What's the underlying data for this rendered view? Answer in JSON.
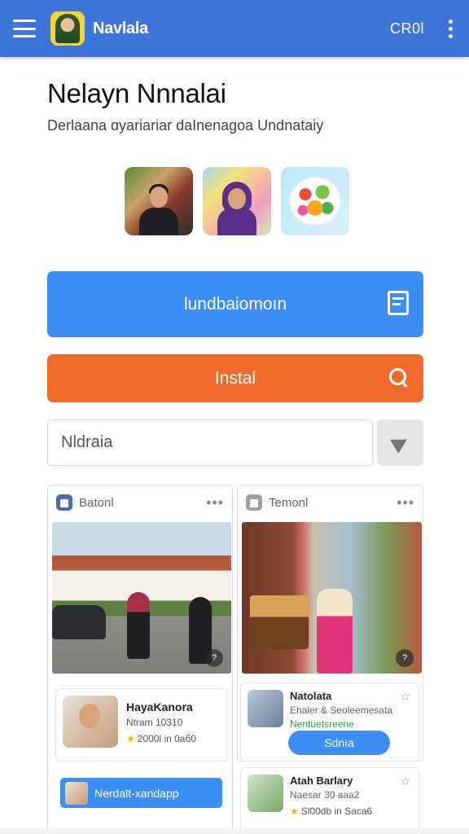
{
  "appbar": {
    "app_name": "Navlala",
    "counter": "CR0l",
    "brand_color": "#3f74d8"
  },
  "header": {
    "title": "Nelayn Nnnalai",
    "subtitle": "Derlaana ɑyariariar daInenagoa Undnataiy"
  },
  "thumbnails": [
    {
      "name": "portrait-man"
    },
    {
      "name": "portrait-woman-hijab"
    },
    {
      "name": "food-bowl"
    }
  ],
  "actions": {
    "primary_label": "lundbaiomoın",
    "install_label": "Instal",
    "primary_color": "#3d8ef2",
    "install_color": "#f06a2c"
  },
  "search": {
    "placeholder": "Nldraia"
  },
  "cards": {
    "left": {
      "title": "Batonl",
      "mini_title": "HayaKanora",
      "mini_sub": "Ntram 10310",
      "mini_rating": "2000l in 0aб0",
      "wide_button_label": "Nerdalt-xandapp"
    },
    "right": {
      "title": "Temonl",
      "item1_title": "Natolata",
      "item1_sub": "Ehaler & Seoleemesata",
      "item1_green": "Nentuetsreene",
      "item1_button": "Sdnıa",
      "item2_title": "Atah Barlary",
      "item2_sub": "Naesar 30 aaa2",
      "item2_rating": "Sl00db in Saca6"
    }
  }
}
